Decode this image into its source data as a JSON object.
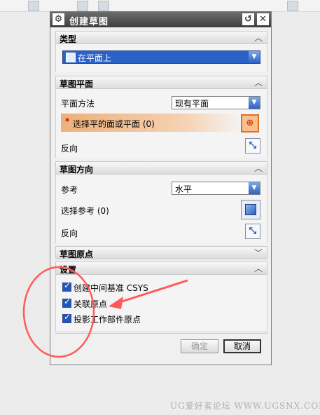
{
  "dialog": {
    "title": "创建草图",
    "icons": {
      "settings": "gear-icon",
      "reset": "reset-icon",
      "close": "close-icon"
    }
  },
  "sections": {
    "type": {
      "header": "类型",
      "dropdown_value": "在平面上"
    },
    "sketch_plane": {
      "header": "草图平面",
      "plane_method_label": "平面方法",
      "plane_method_value": "现有平面",
      "select_label": "选择平的面或平面 (0)",
      "reverse_label": "反向"
    },
    "sketch_orientation": {
      "header": "草图方向",
      "reference_label": "参考",
      "reference_value": "水平",
      "select_ref_label": "选择参考 (0)",
      "reverse_label": "反向"
    },
    "sketch_origin": {
      "header": "草图原点"
    },
    "settings": {
      "header": "设置",
      "checkboxes": [
        {
          "label": "创建中间基准 CSYS",
          "checked": true
        },
        {
          "label": "关联原点",
          "checked": true
        },
        {
          "label": "投影工作部件原点",
          "checked": true
        }
      ]
    }
  },
  "footer": {
    "ok_label": "确定",
    "cancel_label": "取消"
  },
  "watermark": "UG爱好者论坛 WWW.UGSNX.COM",
  "colors": {
    "selection_accent": "#f0b080",
    "annotation": "#ff5a5a",
    "checkbox": "#2156b8"
  }
}
